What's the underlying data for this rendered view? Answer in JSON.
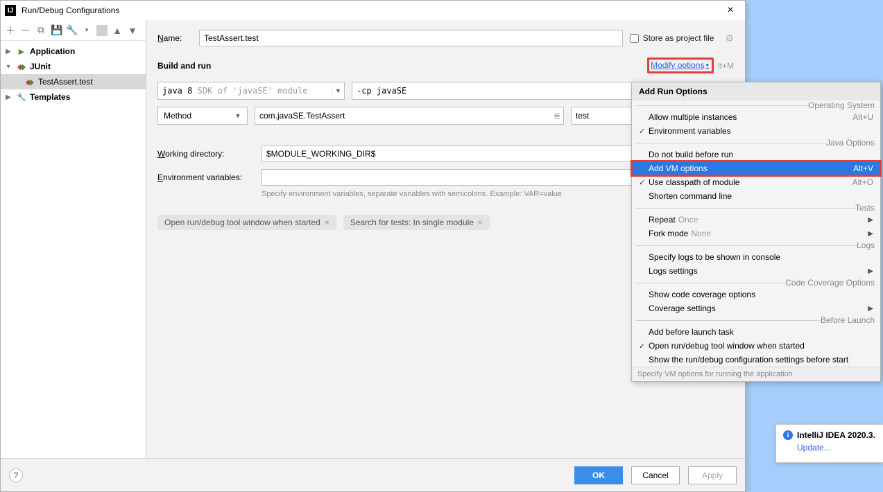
{
  "titlebar": {
    "title": "Run/Debug Configurations"
  },
  "sidebar": {
    "items": [
      {
        "name": "application",
        "label": "Application",
        "expandable": true,
        "expanded": false,
        "bold": true
      },
      {
        "name": "junit",
        "label": "JUnit",
        "expandable": true,
        "expanded": true,
        "bold": true
      },
      {
        "name": "testassert",
        "label": "TestAssert.test",
        "indent": 2,
        "selected": true
      },
      {
        "name": "templates",
        "label": "Templates",
        "expandable": true,
        "expanded": false,
        "bold": true
      }
    ]
  },
  "form": {
    "name_label": "Name:",
    "name_value": "TestAssert.test",
    "store_label": "Store as project file",
    "buildrun_label": "Build and run",
    "modify_label": "Modify options",
    "modify_shortcut": "lt+M",
    "jdk_prefix": "java 8",
    "jdk_hint": "SDK of 'javaSE' module",
    "cp_value": "-cp javaSE",
    "scope_label": "Method",
    "class_value": "com.javaSE.TestAssert",
    "method_value": "test",
    "wd_label": "Working directory:",
    "wd_value": "$MODULE_WORKING_DIR$",
    "env_label": "Environment variables:",
    "env_hint": "Specify environment variables, separate variables with semicolons. Example: VAR=value",
    "pill1": "Open run/debug tool window when started",
    "pill2": "Search for tests: In single module"
  },
  "footer": {
    "ok": "OK",
    "cancel": "Cancel",
    "apply": "Apply"
  },
  "popup": {
    "head": "Add Run Options",
    "groups": [
      {
        "label": "Operating System",
        "items": [
          {
            "label": "Allow multiple instances",
            "shortcut": "Alt+U"
          },
          {
            "label": "Environment variables",
            "checked": true
          }
        ]
      },
      {
        "label": "Java Options",
        "items": [
          {
            "label": "Do not build before run"
          },
          {
            "label": "Add VM options",
            "shortcut": "Alt+V",
            "highlight": true
          },
          {
            "label": "Use classpath of module",
            "shortcut": "Alt+O",
            "checked": true
          },
          {
            "label": "Shorten command line"
          }
        ]
      },
      {
        "label": "Tests",
        "items": [
          {
            "label": "Repeat",
            "value": "Once",
            "submenu": true
          },
          {
            "label": "Fork mode",
            "value": "None",
            "submenu": true
          }
        ]
      },
      {
        "label": "Logs",
        "items": [
          {
            "label": "Specify logs to be shown in console"
          },
          {
            "label": "Logs settings",
            "submenu": true
          }
        ]
      },
      {
        "label": "Code Coverage Options",
        "items": [
          {
            "label": "Show code coverage options"
          },
          {
            "label": "Coverage settings",
            "submenu": true
          }
        ]
      },
      {
        "label": "Before Launch",
        "items": [
          {
            "label": "Add before launch task"
          },
          {
            "label": "Open run/debug tool window when started",
            "checked": true
          },
          {
            "label": "Show the run/debug configuration settings before start"
          }
        ]
      }
    ],
    "footer_hint": "Specify VM options for running the application"
  },
  "notification": {
    "title": "IntelliJ IDEA 2020.3.",
    "link": "Update..."
  }
}
